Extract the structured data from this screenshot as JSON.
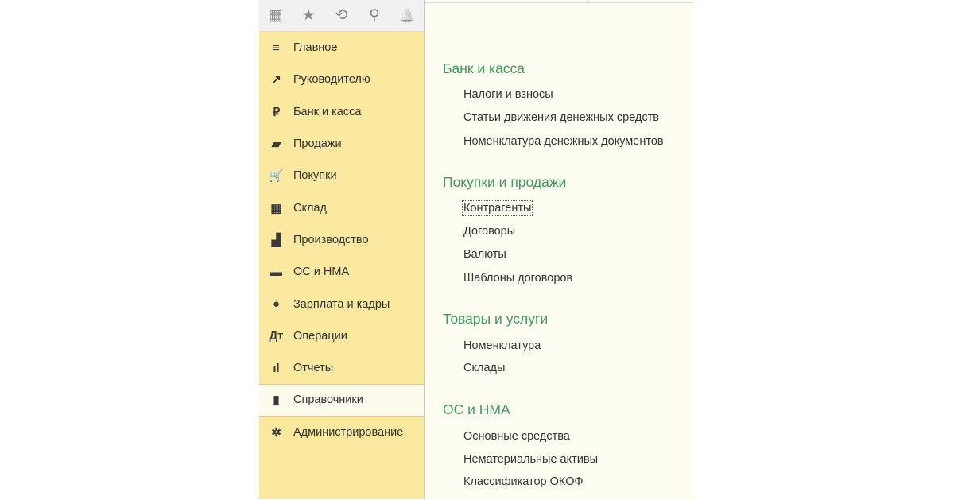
{
  "toolbar": {
    "apps": "▦",
    "favorites": "★",
    "history": "⟲",
    "search": "⚲",
    "notifications": "🔔"
  },
  "sidebar": {
    "items": [
      {
        "label": "Главное",
        "icon": "≡"
      },
      {
        "label": "Руководителю",
        "icon": "↗"
      },
      {
        "label": "Банк и касса",
        "icon": "₽"
      },
      {
        "label": "Продажи",
        "icon": "▰"
      },
      {
        "label": "Покупки",
        "icon": "🛒"
      },
      {
        "label": "Склад",
        "icon": "▦"
      },
      {
        "label": "Производство",
        "icon": "▟"
      },
      {
        "label": "ОС и НМА",
        "icon": "▬"
      },
      {
        "label": "Зарплата и кадры",
        "icon": "●"
      },
      {
        "label": "Операции",
        "icon": "Дт"
      },
      {
        "label": "Отчеты",
        "icon": "ıl"
      },
      {
        "label": "Справочники",
        "icon": "▮"
      },
      {
        "label": "Администрирование",
        "icon": "✲"
      }
    ],
    "active": "Справочники"
  },
  "main": {
    "sections": [
      {
        "title": "Банк и касса",
        "links": [
          "Налоги и взносы",
          "Статьи движения денежных средств",
          "Номенклатура денежных документов"
        ]
      },
      {
        "title": "Покупки и продажи",
        "links": [
          "Контрагенты",
          "Договоры",
          "Валюты",
          "Шаблоны договоров"
        ]
      },
      {
        "title": "Товары и услуги",
        "links": [
          "Номенклатура",
          "Склады"
        ]
      },
      {
        "title": "ОС и НМА",
        "links": [
          "Основные средства",
          "Нематериальные активы",
          "Классификатор ОКОФ"
        ]
      }
    ]
  }
}
